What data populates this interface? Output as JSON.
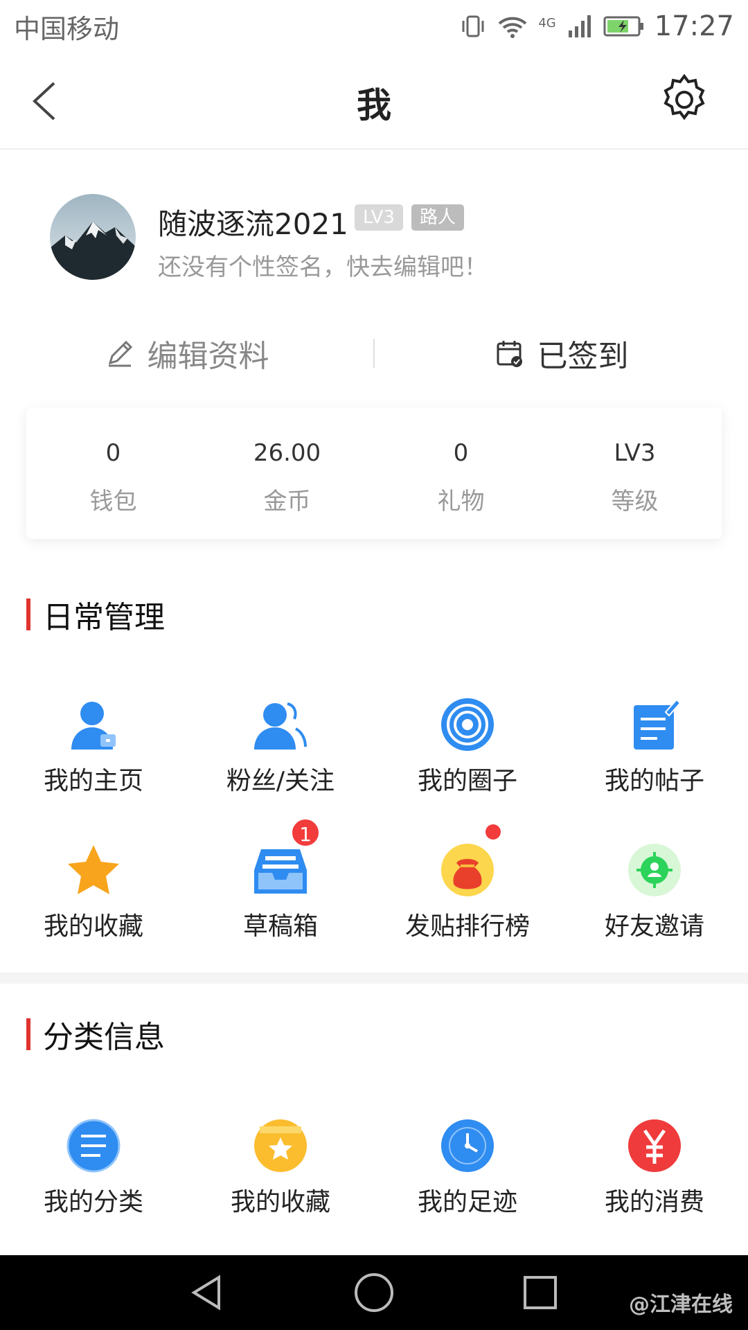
{
  "status_bar": {
    "carrier": "中国移动",
    "network": "4G",
    "time": "17:27"
  },
  "header": {
    "title": "我"
  },
  "profile": {
    "username": "随波逐流2021",
    "level_badge": "LV3",
    "role_badge": "路人",
    "signature": "还没有个性签名，快去编辑吧！"
  },
  "actions": {
    "edit_label": "编辑资料",
    "sign_label": "已签到"
  },
  "stats": [
    {
      "value": "0",
      "label": "钱包"
    },
    {
      "value": "26.00",
      "label": "金币"
    },
    {
      "value": "0",
      "label": "礼物"
    },
    {
      "value": "LV3",
      "label": "等级"
    }
  ],
  "daily": {
    "title": "日常管理",
    "items": [
      {
        "label": "我的主页",
        "icon": "user-home-icon"
      },
      {
        "label": "粉丝/关注",
        "icon": "fans-icon"
      },
      {
        "label": "我的圈子",
        "icon": "circle-icon"
      },
      {
        "label": "我的帖子",
        "icon": "post-icon"
      },
      {
        "label": "我的收藏",
        "icon": "star-icon"
      },
      {
        "label": "草稿箱",
        "icon": "drafts-icon",
        "badge": "1"
      },
      {
        "label": "发贴排行榜",
        "icon": "ranking-bag-icon"
      },
      {
        "label": "好友邀请",
        "icon": "invite-icon"
      }
    ]
  },
  "category": {
    "title": "分类信息",
    "items": [
      {
        "label": "我的分类",
        "icon": "list-icon"
      },
      {
        "label": "我的收藏",
        "icon": "favorite-box-icon"
      },
      {
        "label": "我的足迹",
        "icon": "clock-icon"
      },
      {
        "label": "我的消费",
        "icon": "yuan-icon"
      }
    ]
  },
  "watermark": "@江津在线",
  "colors": {
    "accent_red": "#e0332f",
    "icon_blue": "#2f8cf0",
    "badge_red": "#f23c3c"
  }
}
